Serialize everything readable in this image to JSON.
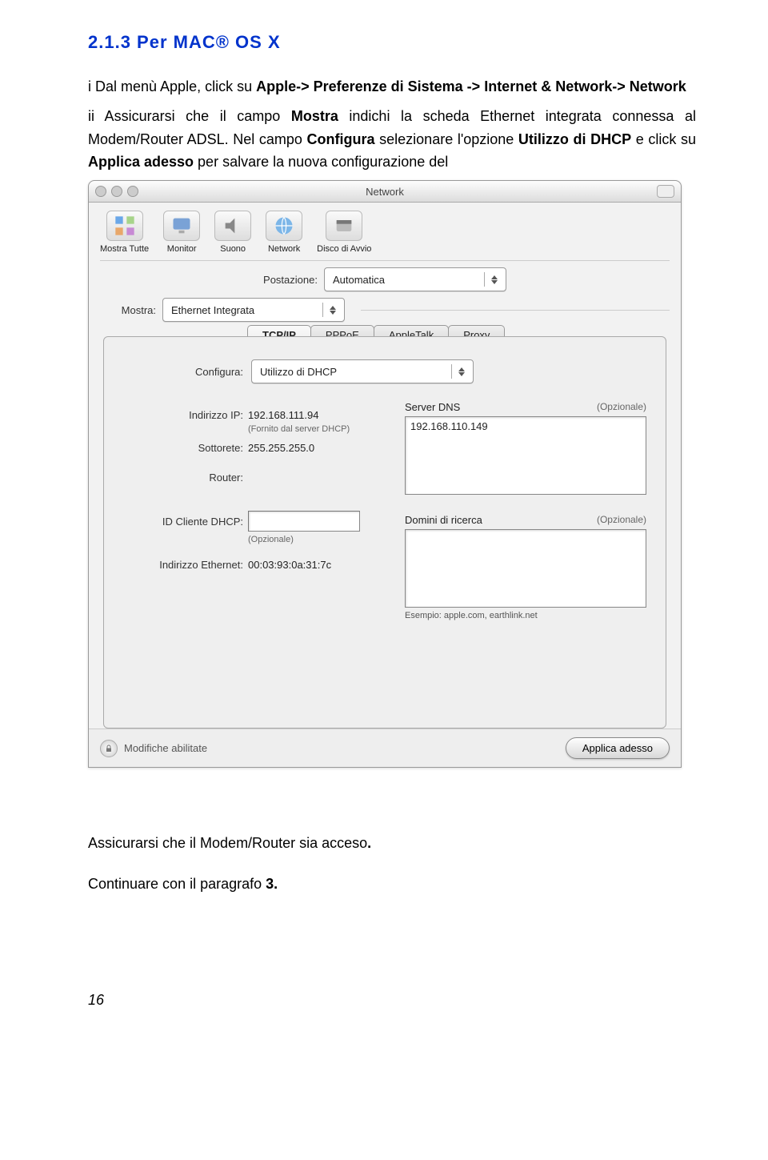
{
  "section_title": "2.1.3 Per MAC® OS X",
  "para_i_a": "i  Dal menù Apple, click su ",
  "para_i_b1": "Apple->  Preferenze di Sistema -> Internet & Network-> Network",
  "para_ii_a": "ii  Assicurarsi che il campo ",
  "para_ii_b1": "Mostra",
  "para_ii_c": " indichi la scheda Ethernet integrata connessa al Modem/Router ADSL. Nel campo ",
  "para_ii_b2": "Configura",
  "para_ii_d": " selezionare l'opzione ",
  "para_ii_b3": "Utilizzo di DHCP",
  "para_ii_e": " e click su ",
  "para_ii_b4": "Applica adesso",
  "para_ii_f": " per salvare la nuova configurazione del",
  "window": {
    "title": "Network",
    "toolbar": [
      {
        "label": "Mostra Tutte"
      },
      {
        "label": "Monitor"
      },
      {
        "label": "Suono"
      },
      {
        "label": "Network"
      },
      {
        "label": "Disco di Avvio"
      }
    ],
    "postazione_label": "Postazione:",
    "postazione_value": "Automatica",
    "mostra_label": "Mostra:",
    "mostra_value": "Ethernet Integrata",
    "tabs": [
      "TCP/IP",
      "PPPoE",
      "AppleTalk",
      "Proxy"
    ],
    "active_tab": "TCP/IP",
    "configura_label": "Configura:",
    "configura_value": "Utilizzo di DHCP",
    "ip_label": "Indirizzo IP:",
    "ip_value": "192.168.111.94",
    "ip_note": "(Fornito dal server DHCP)",
    "subnet_label": "Sottorete:",
    "subnet_value": "255.255.255.0",
    "router_label": "Router:",
    "dhcp_id_label": "ID Cliente DHCP:",
    "dhcp_id_note": "(Opzionale)",
    "eth_label": "Indirizzo Ethernet:",
    "eth_value": "00:03:93:0a:31:7c",
    "dns_label": "Server DNS",
    "dns_opt": "(Opzionale)",
    "dns_value": "192.168.110.149",
    "search_label": "Domini di ricerca",
    "search_opt": "(Opzionale)",
    "example": "Esempio: apple.com, earthlink.net",
    "lock_text": "Modifiche abilitate",
    "apply_btn": "Applica adesso"
  },
  "after_1": "Assicurarsi che il Modem/Router sia acceso",
  "after_1_dot": ".",
  "after_2a": "Continuare con il paragrafo ",
  "after_2b": "3.",
  "page_number": "16"
}
